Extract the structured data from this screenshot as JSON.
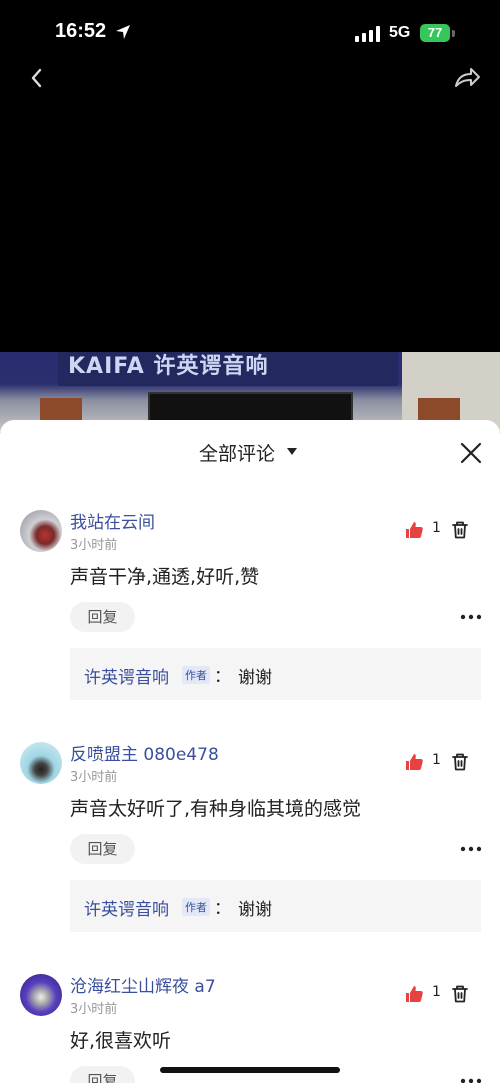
{
  "status_bar": {
    "time": "16:52",
    "network": "5G",
    "battery": "77"
  },
  "icons": {
    "back": "chevron-left-icon",
    "share": "share-arrow-icon",
    "close": "close-icon",
    "like": "thumbs-up-icon",
    "delete": "trash-icon",
    "more": "more-dots-icon"
  },
  "video": {
    "banner_text": "KAIFA 许英谔音响"
  },
  "comments_sheet": {
    "title": "全部评论",
    "comments": [
      {
        "username": "我站在云间",
        "time": "3小时前",
        "text": "声音干净,通透,好听,赞",
        "likes": "1",
        "reply_label": "回复",
        "reply": {
          "author": "许英谔音响",
          "badge": "作者",
          "colon": "：",
          "text": "谢谢"
        }
      },
      {
        "username": "反喷盟主 080e478",
        "time": "3小时前",
        "text": "声音太好听了,有种身临其境的感觉",
        "likes": "1",
        "reply_label": "回复",
        "reply": {
          "author": "许英谔音响",
          "badge": "作者",
          "colon": "：",
          "text": "谢谢"
        }
      },
      {
        "username": "沧海红尘山辉夜 a7",
        "time": "3小时前",
        "text": "好,很喜欢听",
        "likes": "1",
        "reply_label": "回复"
      }
    ]
  },
  "colors": {
    "accent_blue": "#3a4f9e",
    "like_red": "#e64340",
    "battery_green": "#35c759"
  }
}
